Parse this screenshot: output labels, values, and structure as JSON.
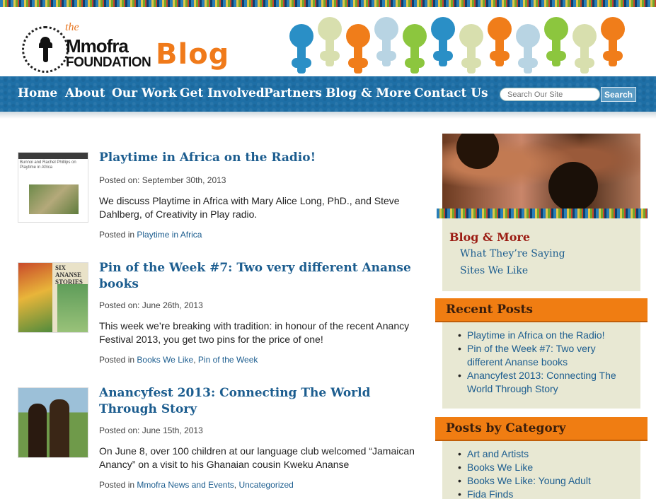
{
  "header": {
    "logo_the": "the",
    "logo_name": "Mmofra",
    "logo_foundation": "FOUNDATION",
    "logo_blog": "Blog"
  },
  "nav": {
    "items": [
      "Home",
      "About",
      "Our Work",
      "Get Involved",
      "Partners",
      "Blog & More",
      "Contact Us"
    ],
    "search_placeholder": "Search Our Site",
    "search_button": "Search"
  },
  "posts": [
    {
      "title": "Playtime in Africa on the Radio!",
      "date": "Posted on: September 30th, 2013",
      "excerpt": "We discuss Playtime in Africa with Mary Alice Long, PhD., and Steve Dahlberg, of Creativity in Play radio.",
      "posted_in": "Posted in",
      "categories": [
        "Playtime in Africa"
      ],
      "thumb_text": "Bunnoi and Rachel Phillips on Playtime in Africa"
    },
    {
      "title": "Pin of the Week #7: Two very different Ananse books",
      "date": "Posted on: June 26th, 2013",
      "excerpt": "This week we’re breaking with tradition: in honour of the recent Anancy Festival 2013, you get two pins for the price of one!",
      "posted_in": "Posted in",
      "categories": [
        "Books We Like",
        "Pin of the Week"
      ],
      "thumb_text": "SIX ANANSE STORIES"
    },
    {
      "title": "Anancyfest 2013: Connecting The World Through Story",
      "date": "Posted on: June 15th, 2013",
      "excerpt": "On June 8, over 100 children at our language club welcomed “Jamaican Anancy” on a visit to his Ghanaian cousin Kweku Ananse",
      "posted_in": "Posted in",
      "categories": [
        "Mmofra News and Events",
        "Uncategorized"
      ]
    }
  ],
  "sidebar": {
    "blog_more": {
      "title": "Blog & More",
      "links": [
        "What They’re Saying",
        "Sites We Like"
      ]
    },
    "recent_posts": {
      "title": "Recent Posts",
      "items": [
        "Playtime in Africa on the Radio!",
        "Pin of the Week #7: Two very different Ananse books",
        "Anancyfest 2013: Connecting The World Through Story"
      ]
    },
    "categories": {
      "title": "Posts by Category",
      "items": [
        "Art and Artists",
        "Books We Like",
        "Books We Like: Young Adult",
        "Fida Finds"
      ]
    }
  },
  "colors": {
    "nav_blue": "#1e6fa6",
    "title_blue": "#1c5d8f",
    "orange": "#f07d12",
    "sidebar_bg": "#e8e8d3",
    "blog_more_red": "#9b1b12"
  }
}
